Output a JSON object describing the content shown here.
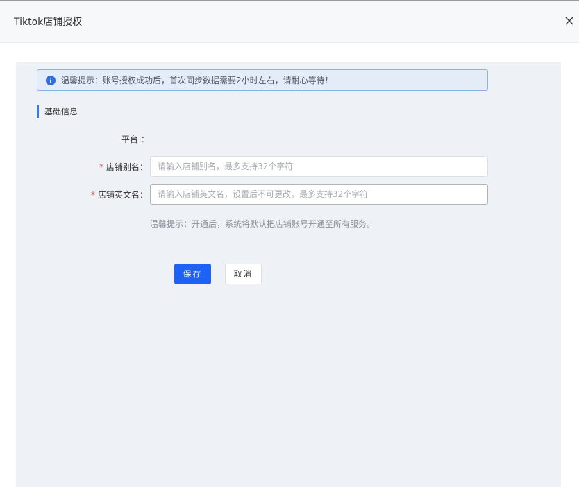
{
  "modal": {
    "title": "Tiktok店铺授权",
    "close_icon": "close-icon"
  },
  "alert": {
    "icon": "info-icon",
    "text": "温馨提示：账号授权成功后，首次同步数据需要2小时左右，请耐心等待！"
  },
  "section": {
    "title": "基础信息"
  },
  "form": {
    "platform": {
      "label": "平台 ：",
      "value": ""
    },
    "alias": {
      "required_mark": "*",
      "label": "店铺别名：",
      "value": "",
      "placeholder": "请输入店铺别名，最多支持32个字符"
    },
    "english_name": {
      "required_mark": "*",
      "label": "店铺英文名：",
      "value": "",
      "placeholder": "请输入店铺英文名，设置后不可更改，最多支持32个字符"
    },
    "hint": "温馨提示：开通后，系统将默认把店铺账号开通至所有服务。"
  },
  "actions": {
    "save_label": "保存",
    "cancel_label": "取消"
  },
  "colors": {
    "primary": "#1d62f5",
    "required": "#e23b3b",
    "alert_bg": "#e4ecf8",
    "alert_border": "#8fb0e6",
    "panel_bg": "#eef1f5"
  }
}
